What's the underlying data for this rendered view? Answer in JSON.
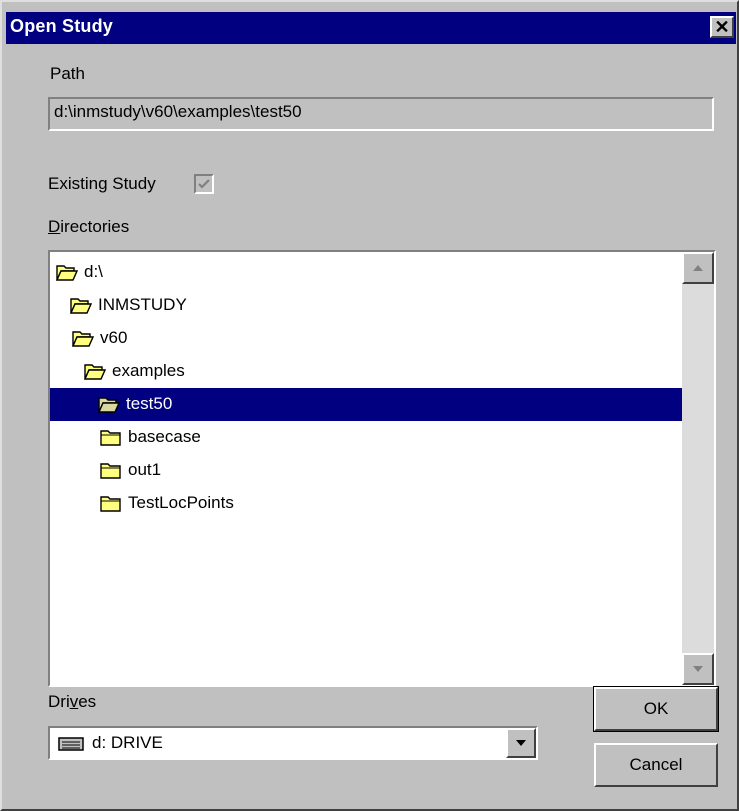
{
  "window": {
    "title": "Open Study",
    "close_glyph": "✕"
  },
  "path": {
    "label": "Path",
    "value": "d:\\inmstudy\\v60\\examples\\test50"
  },
  "existing_study": {
    "label": "Existing Study",
    "checked": true
  },
  "directories": {
    "label_first": "D",
    "label_rest": "irectories",
    "items": [
      {
        "name": "d:\\",
        "icon": "folder-open-icon",
        "selected": false
      },
      {
        "name": "INMSTUDY",
        "icon": "folder-open-icon",
        "selected": false
      },
      {
        "name": "v60",
        "icon": "folder-open-icon",
        "selected": false
      },
      {
        "name": "examples",
        "icon": "folder-open-icon",
        "selected": false
      },
      {
        "name": "test50",
        "icon": "folder-open-icon",
        "selected": true
      },
      {
        "name": "basecase",
        "icon": "folder-closed-icon",
        "selected": false
      },
      {
        "name": "out1",
        "icon": "folder-closed-icon",
        "selected": false
      },
      {
        "name": "TestLocPoints",
        "icon": "folder-closed-icon",
        "selected": false
      }
    ]
  },
  "drives": {
    "label_pre": "Dri",
    "label_u": "v",
    "label_post": "es",
    "selected": "d: DRIVE"
  },
  "buttons": {
    "ok": "OK",
    "cancel": "Cancel"
  },
  "colors": {
    "titlebar": "#000080",
    "selection": "#000080",
    "face": "#c0c0c0",
    "folder": "#ffff80"
  }
}
